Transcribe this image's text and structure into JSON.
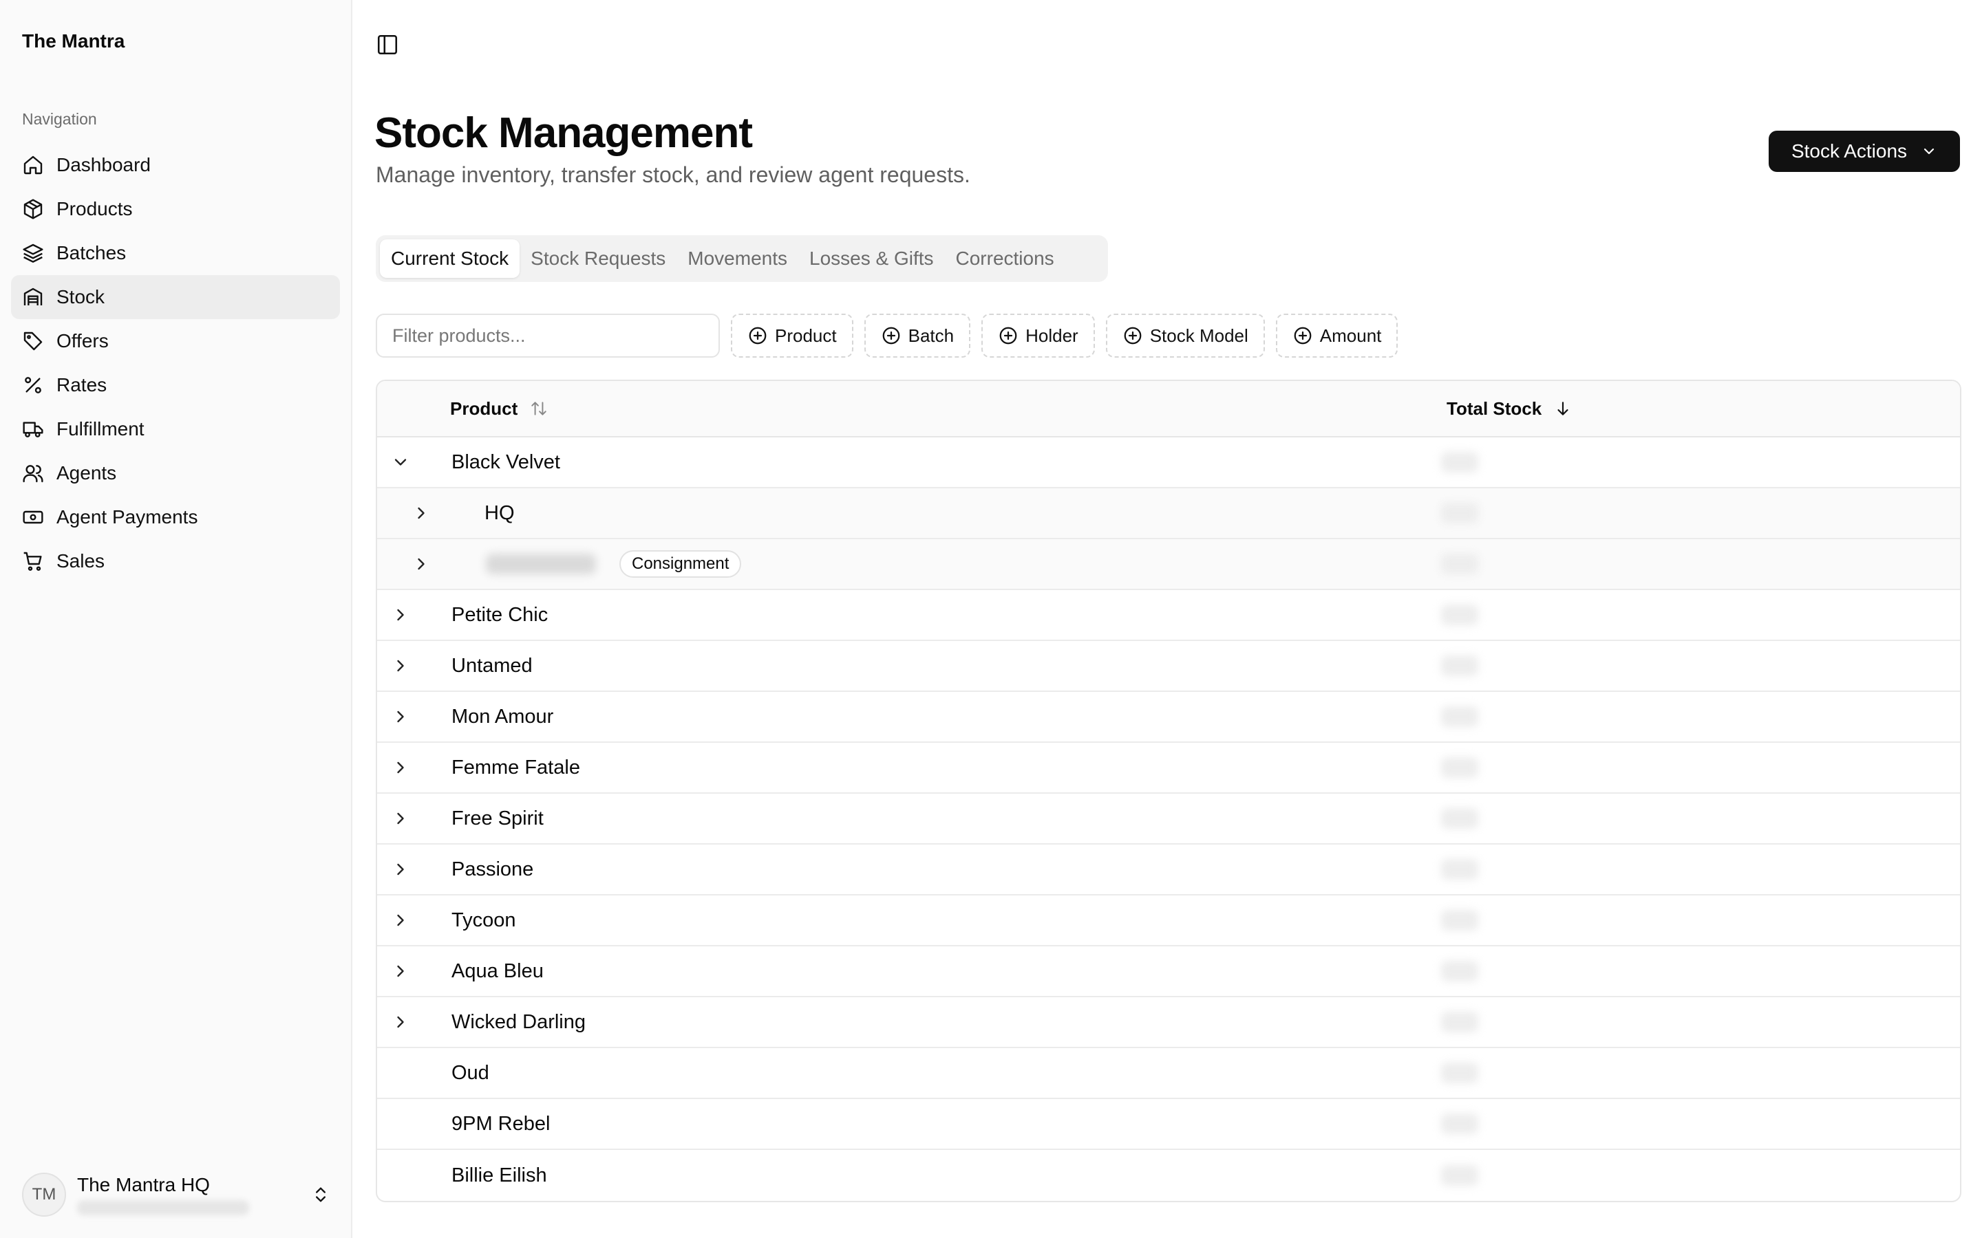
{
  "sidebar": {
    "brand": "The Mantra",
    "nav_label": "Navigation",
    "items": [
      {
        "label": "Dashboard",
        "icon": "home-icon"
      },
      {
        "label": "Products",
        "icon": "package-icon"
      },
      {
        "label": "Batches",
        "icon": "layers-icon"
      },
      {
        "label": "Stock",
        "icon": "warehouse-icon",
        "active": true
      },
      {
        "label": "Offers",
        "icon": "tag-icon"
      },
      {
        "label": "Rates",
        "icon": "percent-icon"
      },
      {
        "label": "Fulfillment",
        "icon": "truck-icon"
      },
      {
        "label": "Agents",
        "icon": "users-icon"
      },
      {
        "label": "Agent Payments",
        "icon": "banknote-icon"
      },
      {
        "label": "Sales",
        "icon": "cart-icon"
      }
    ],
    "user": {
      "initials": "TM",
      "name": "The Mantra HQ"
    }
  },
  "header": {
    "title": "Stock Management",
    "subtitle": "Manage inventory, transfer stock, and review agent requests.",
    "actions_label": "Stock Actions"
  },
  "tabs": [
    "Current Stock",
    "Stock Requests",
    "Movements",
    "Losses & Gifts",
    "Corrections"
  ],
  "filters": {
    "placeholder": "Filter products...",
    "chips": [
      "Product",
      "Batch",
      "Holder",
      "Stock Model",
      "Amount"
    ]
  },
  "table": {
    "columns": {
      "product": "Product",
      "total_stock": "Total Stock"
    },
    "rows": [
      {
        "name": "Black Velvet",
        "expandable": true,
        "expanded": true
      },
      {
        "name": "HQ",
        "expandable": true,
        "level": 1
      },
      {
        "name": "",
        "badge": "Consignment",
        "expandable": true,
        "level": 1
      },
      {
        "name": "Petite Chic",
        "expandable": true
      },
      {
        "name": "Untamed",
        "expandable": true
      },
      {
        "name": "Mon Amour",
        "expandable": true
      },
      {
        "name": "Femme Fatale",
        "expandable": true
      },
      {
        "name": "Free Spirit",
        "expandable": true
      },
      {
        "name": "Passione",
        "expandable": true
      },
      {
        "name": "Tycoon",
        "expandable": true
      },
      {
        "name": "Aqua Bleu",
        "expandable": true
      },
      {
        "name": "Wicked Darling",
        "expandable": true
      },
      {
        "name": "Oud",
        "expandable": false
      },
      {
        "name": "9PM Rebel",
        "expandable": false
      },
      {
        "name": "Billie Eilish",
        "expandable": false
      }
    ]
  }
}
